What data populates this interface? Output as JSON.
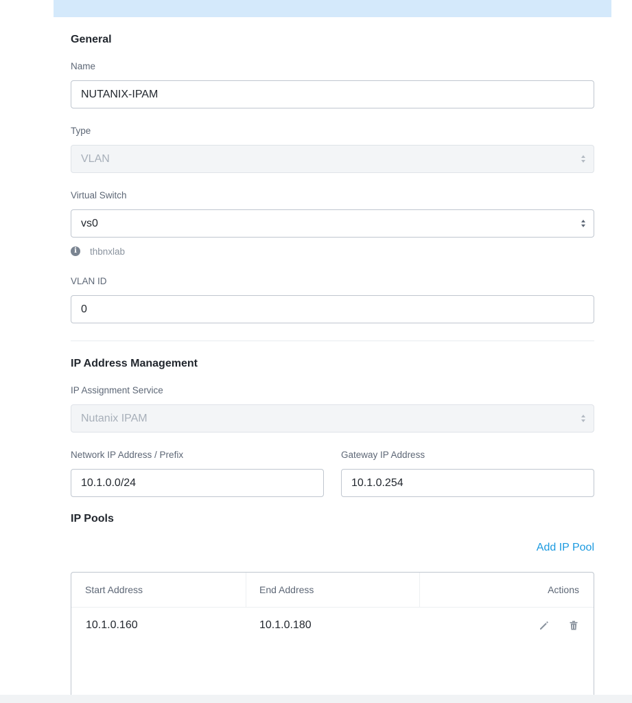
{
  "sections": {
    "general": "General",
    "ipam": "IP Address Management",
    "pools": "IP Pools"
  },
  "fields": {
    "name": {
      "label": "Name",
      "value": "NUTANIX-IPAM"
    },
    "type": {
      "label": "Type",
      "value": "VLAN"
    },
    "virtual_switch": {
      "label": "Virtual Switch",
      "value": "vs0",
      "hint": "thbnxlab"
    },
    "vlan_id": {
      "label": "VLAN ID",
      "value": "0"
    },
    "ip_assignment": {
      "label": "IP Assignment Service",
      "value": "Nutanix IPAM"
    },
    "network_prefix": {
      "label": "Network IP Address / Prefix",
      "value": "10.1.0.0/24"
    },
    "gateway": {
      "label": "Gateway IP Address",
      "value": "10.1.0.254"
    }
  },
  "pools": {
    "add_label": "Add IP Pool",
    "columns": [
      "Start Address",
      "End Address",
      "Actions"
    ],
    "rows": [
      {
        "start": "10.1.0.160",
        "end": "10.1.0.180"
      }
    ]
  },
  "icons": {
    "info": "info-icon",
    "edit": "pencil-icon",
    "delete": "trash-icon"
  },
  "colors": {
    "accent": "#1b9ae0",
    "banner": "#d4e9fb",
    "icon": "#7a8491"
  }
}
